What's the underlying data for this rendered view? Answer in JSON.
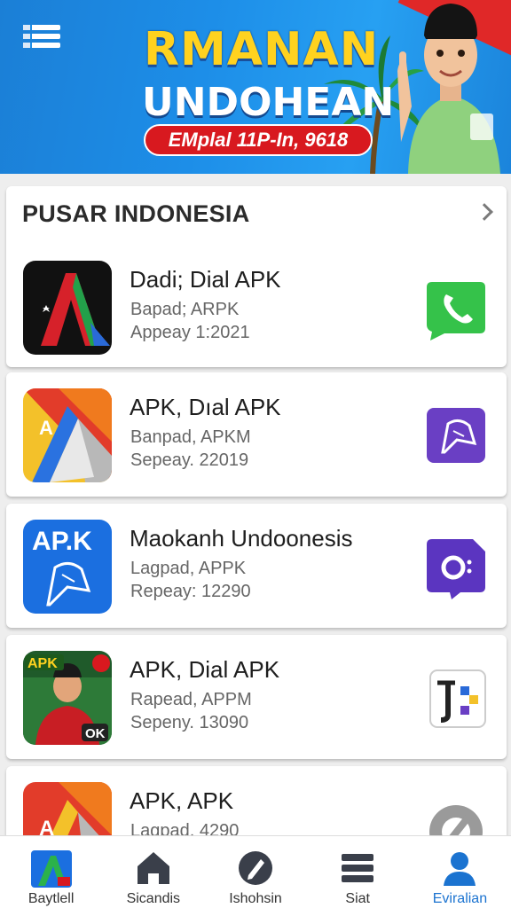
{
  "banner": {
    "title": "RMANAN",
    "subtitle": "UNDOHEAN",
    "pill": "EMplal 11P-In, 9618"
  },
  "section": {
    "title": "PUSAR INDONESIA"
  },
  "apps": [
    {
      "name": "Dadi; Dial APK",
      "line1": "Bapad; ARPK",
      "line2": "Appeay 1:2021",
      "action_icon": "phone-icon"
    },
    {
      "name": "APK, Dıal APK",
      "line1": "Banpad, APKM",
      "line2": "Sepeay. 22019",
      "action_icon": "bird-icon"
    },
    {
      "name": "Maokanh Undoonesis",
      "line1": "Lagpad, APPK",
      "line2": "Repeay: 12290",
      "action_icon": "chat-icon"
    },
    {
      "name": "APK, Dial APK",
      "line1": "Rapead, APPM",
      "line2": "Sepeny. 13090",
      "action_icon": "docs-icon"
    },
    {
      "name": "APK, APK",
      "line1": "Lagpad, 4290",
      "line2": "",
      "action_icon": "settings-icon"
    }
  ],
  "app_icons": {
    "icon4_badge": "APK",
    "icon4_ok": "OK",
    "icon3_text": "AP.K"
  },
  "nav": [
    {
      "label": "Baytlell",
      "icon": "app-logo-icon",
      "active": false
    },
    {
      "label": "Sicandis",
      "icon": "home-icon",
      "active": false
    },
    {
      "label": "Ishohsin",
      "icon": "edit-icon",
      "active": false
    },
    {
      "label": "Siat",
      "icon": "list-icon",
      "active": false
    },
    {
      "label": "Eviralian",
      "icon": "person-icon",
      "active": true
    }
  ],
  "colors": {
    "accent": "#1b73d0",
    "banner_blue": "#1d8ee8",
    "pill_red": "#d8191f",
    "title_yellow": "#ffd21f"
  }
}
